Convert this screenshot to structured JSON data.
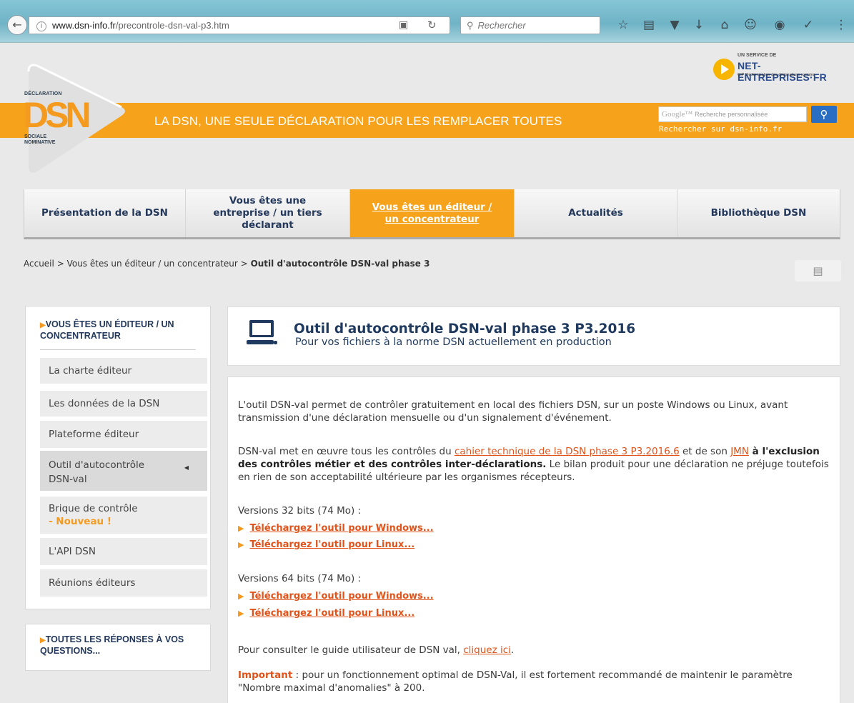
{
  "browser": {
    "url_host": "www.dsn-info.fr",
    "url_path": "/precontrole-dsn-val-p3.htm",
    "search_placeholder": "Rechercher"
  },
  "header": {
    "logo_top": "DÉCLARATION",
    "logo_main": "DSN",
    "logo_bottom": "SOCIALE NOMINATIVE",
    "tagline": "LA DSN, UNE SEULE DÉCLARATION POUR LES REMPLACER TOUTES",
    "service_label": "UN SERVICE DE",
    "service_name": "NET-ENTREPRISES·FR",
    "service_sub": "GIP Modernisation des déclarations sociales",
    "google_label": "Google™",
    "google_placeholder": "Recherche personnalisée",
    "search_subtext": "Rechercher sur dsn-info.fr",
    "colors": {
      "orange": "#f7a21b",
      "navy": "#23385b",
      "link": "#e0531a"
    }
  },
  "nav": {
    "tabs": [
      {
        "label": "Présentation de la DSN"
      },
      {
        "label": "Vous êtes une entreprise / un tiers déclarant"
      },
      {
        "label": "Vous êtes un éditeur / un concentrateur"
      },
      {
        "label": "Actualités"
      },
      {
        "label": "Bibliothèque DSN"
      }
    ]
  },
  "breadcrumb": {
    "home": "Accueil",
    "section": "Vous êtes un éditeur / un concentrateur",
    "current": "Outil d'autocontrôle DSN-val phase 3",
    "sep": ">"
  },
  "sidebar": {
    "title": "VOUS ÊTES UN ÉDITEUR / UN CONCENTRATEUR",
    "items": [
      {
        "label": "La charte éditeur"
      },
      {
        "label": "Les données de la DSN"
      },
      {
        "label": "Plateforme éditeur"
      },
      {
        "label": "Outil d'autocontrôle DSN-val"
      },
      {
        "label": "Brique de contrôle",
        "badge": "- Nouveau !"
      },
      {
        "label": "L'API DSN"
      },
      {
        "label": "Réunions éditeurs"
      }
    ],
    "faq_title": "TOUTES LES RÉPONSES À VOS QUESTIONS..."
  },
  "main": {
    "title": "Outil d'autocontrôle DSN-val phase 3 P3.2016",
    "subtitle": "Pour vos fichiers à la norme DSN actuellement en production",
    "intro": "L'outil DSN-val permet de contrôler gratuitement en local des fichiers DSN, sur un poste Windows ou Linux, avant transmission d'une déclaration mensuelle ou d'un signalement d'événement.",
    "p2_a": "DSN-val met en œuvre tous les contrôles du ",
    "p2_link1": "cahier technique de la DSN phase 3 P3.2016.6",
    "p2_b": " et de son ",
    "p2_link2": "JMN",
    "p2_c": " à ",
    "p2_bold": "l'exclusion des contrôles métier et des contrôles inter-déclarations.",
    "p2_d": " Le bilan produit pour une déclaration ne préjuge toutefois en rien de son acceptabilité ultérieure par les organismes récepteurs.",
    "v32": "Versions 32 bits (74 Mo) :",
    "v64": "Versions 64 bits (74 Mo) :",
    "dl_windows": "Téléchargez l'outil pour Windows...",
    "dl_linux": "Téléchargez l'outil pour Linux...",
    "guide_a": "Pour consulter le guide utilisateur de DSN val, ",
    "guide_link": "cliquez ici",
    "guide_b": ".",
    "important_label": "Important",
    "important_text": " : pour un fonctionnement optimal de DSN-Val, il est fortement recommandé de maintenir le paramètre \"Nombre maximal d'anomalies\" à 200."
  }
}
